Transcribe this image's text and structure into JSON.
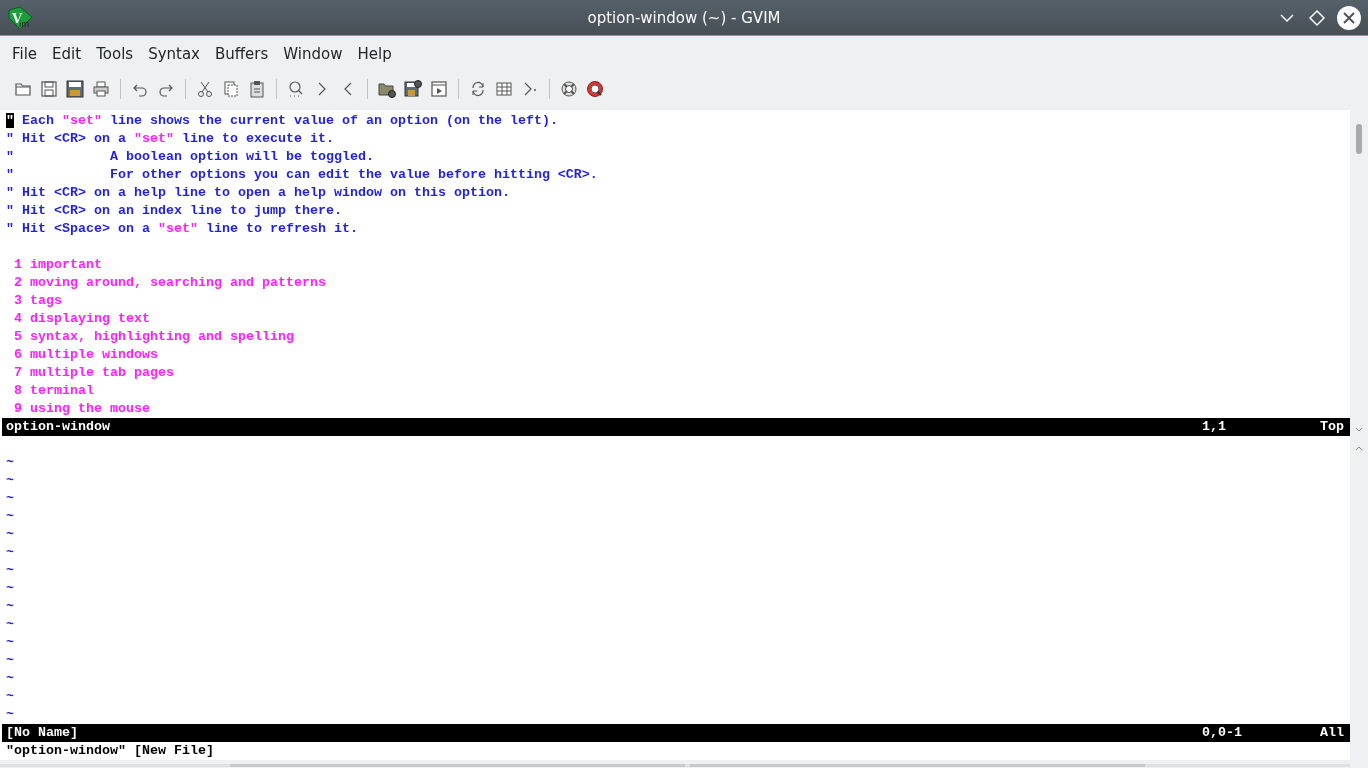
{
  "window": {
    "title": "option-window (~) - GVIM",
    "logo": {
      "letter": "V",
      "suffix": "im"
    }
  },
  "menu": [
    "File",
    "Edit",
    "Tools",
    "Syntax",
    "Buffers",
    "Window",
    "Help"
  ],
  "toolbar": [
    {
      "kind": "open"
    },
    {
      "kind": "save"
    },
    {
      "kind": "save-all"
    },
    {
      "kind": "print"
    },
    {
      "kind": "separator"
    },
    {
      "kind": "undo"
    },
    {
      "kind": "redo"
    },
    {
      "kind": "separator"
    },
    {
      "kind": "cut"
    },
    {
      "kind": "copy"
    },
    {
      "kind": "paste"
    },
    {
      "kind": "separator"
    },
    {
      "kind": "find"
    },
    {
      "kind": "next"
    },
    {
      "kind": "previous"
    },
    {
      "kind": "separator"
    },
    {
      "kind": "load-session"
    },
    {
      "kind": "save-session"
    },
    {
      "kind": "run-script"
    },
    {
      "kind": "separator"
    },
    {
      "kind": "refresh"
    },
    {
      "kind": "table"
    },
    {
      "kind": "jump"
    },
    {
      "kind": "separator"
    },
    {
      "kind": "lifebuoy"
    },
    {
      "kind": "lifebuoy-search"
    }
  ],
  "top_window": {
    "lines": [
      {
        "kind": "comment",
        "segments": [
          {
            "kind": "cursor",
            "text": "\""
          },
          {
            "kind": "comment",
            "text": " Each "
          },
          {
            "kind": "string",
            "text": "\"set\""
          },
          {
            "kind": "comment",
            "text": " line shows the current value of an option (on the left)."
          }
        ]
      },
      {
        "kind": "comment",
        "segments": [
          {
            "kind": "comment",
            "text": "\" Hit <CR> on a "
          },
          {
            "kind": "string",
            "text": "\"set\""
          },
          {
            "kind": "comment",
            "text": " line to execute it."
          }
        ]
      },
      {
        "kind": "comment",
        "segments": [
          {
            "kind": "comment",
            "text": "\"            A boolean option will be toggled."
          }
        ]
      },
      {
        "kind": "comment",
        "segments": [
          {
            "kind": "comment",
            "text": "\"            For other options you can edit the value before hitting <CR>."
          }
        ]
      },
      {
        "kind": "comment",
        "segments": [
          {
            "kind": "comment",
            "text": "\" Hit <CR> on a help line to open a help window on this option."
          }
        ]
      },
      {
        "kind": "comment",
        "segments": [
          {
            "kind": "comment",
            "text": "\" Hit <CR> on an index line to jump there."
          }
        ]
      },
      {
        "kind": "comment",
        "segments": [
          {
            "kind": "comment",
            "text": "\" Hit <Space> on a "
          },
          {
            "kind": "string",
            "text": "\"set\""
          },
          {
            "kind": "comment",
            "text": " line to refresh it."
          }
        ]
      },
      {
        "kind": "blank"
      },
      {
        "kind": "index",
        "number": "1",
        "title": "important"
      },
      {
        "kind": "index",
        "number": "2",
        "title": "moving around, searching and patterns"
      },
      {
        "kind": "index",
        "number": "3",
        "title": "tags"
      },
      {
        "kind": "index",
        "number": "4",
        "title": "displaying text"
      },
      {
        "kind": "index",
        "number": "5",
        "title": "syntax, highlighting and spelling"
      },
      {
        "kind": "index",
        "number": "6",
        "title": "multiple windows"
      },
      {
        "kind": "index",
        "number": "7",
        "title": "multiple tab pages"
      },
      {
        "kind": "index",
        "number": "8",
        "title": "terminal"
      },
      {
        "kind": "index",
        "number": "9",
        "title": "using the mouse"
      }
    ],
    "status": {
      "name": "option-window",
      "ruler": "1,1",
      "position": "Top"
    }
  },
  "bottom_window": {
    "lines": [
      {
        "kind": "blank"
      },
      {
        "kind": "tilde",
        "text": "~"
      },
      {
        "kind": "tilde",
        "text": "~"
      },
      {
        "kind": "tilde",
        "text": "~"
      },
      {
        "kind": "tilde",
        "text": "~"
      },
      {
        "kind": "tilde",
        "text": "~"
      },
      {
        "kind": "tilde",
        "text": "~"
      },
      {
        "kind": "tilde",
        "text": "~"
      },
      {
        "kind": "tilde",
        "text": "~"
      },
      {
        "kind": "tilde",
        "text": "~"
      },
      {
        "kind": "tilde",
        "text": "~"
      },
      {
        "kind": "tilde",
        "text": "~"
      },
      {
        "kind": "tilde",
        "text": "~"
      },
      {
        "kind": "tilde",
        "text": "~"
      },
      {
        "kind": "tilde",
        "text": "~"
      },
      {
        "kind": "tilde",
        "text": "~"
      }
    ],
    "status": {
      "name": "[No Name]",
      "ruler": "0,0-1",
      "position": "All"
    }
  },
  "command_line": "\"option-window\" [New File]"
}
